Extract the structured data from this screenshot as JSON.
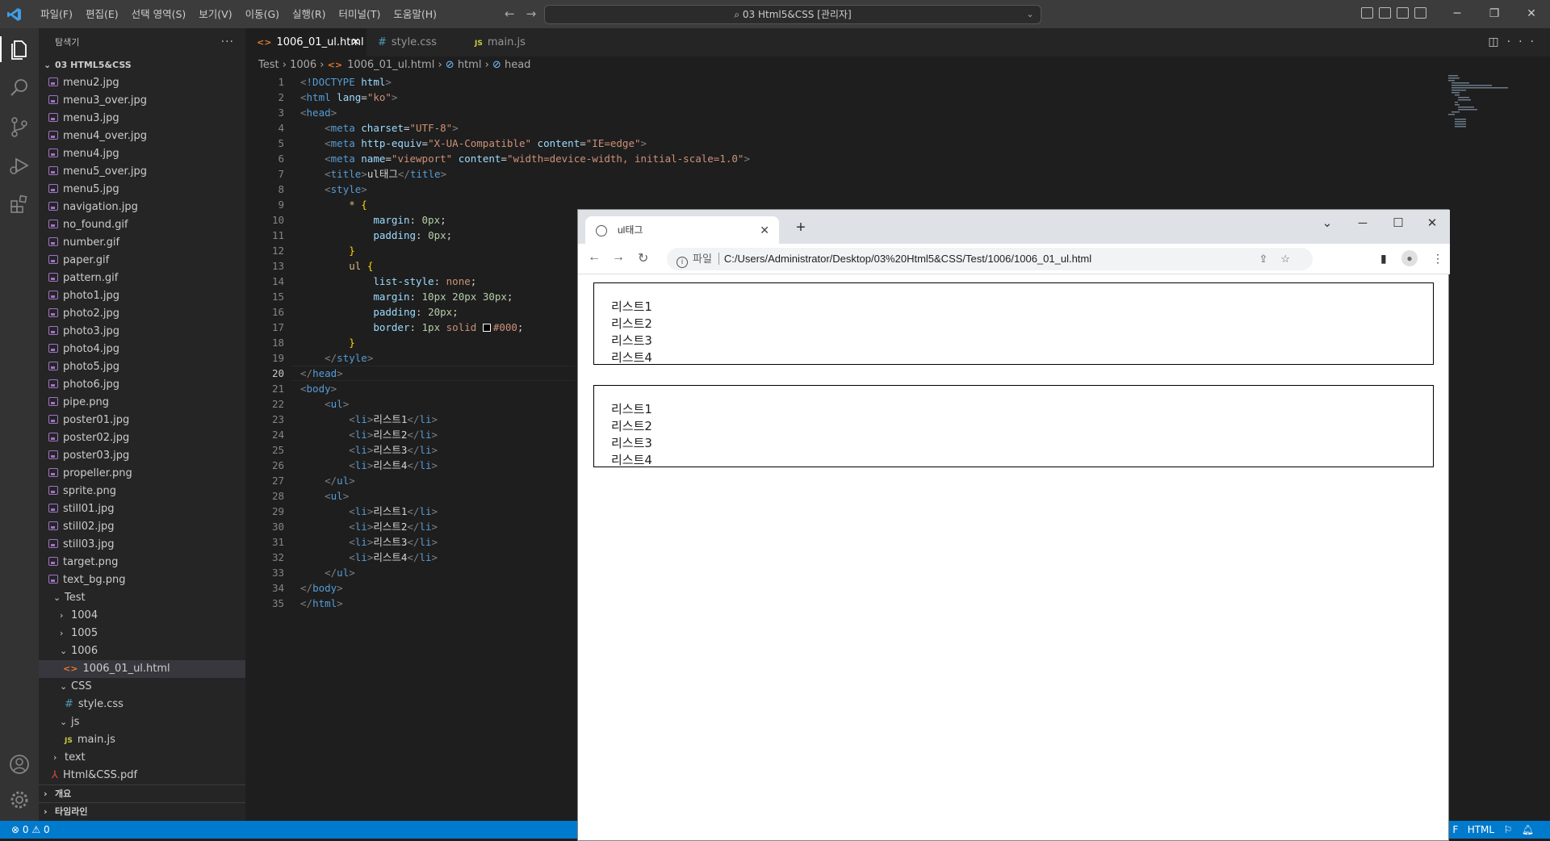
{
  "titlebar": {
    "menus": [
      "파일(F)",
      "편집(E)",
      "선택 영역(S)",
      "보기(V)",
      "이동(G)",
      "실행(R)",
      "터미널(T)",
      "도움말(H)"
    ],
    "command_center": "03 Html5&CSS [관리자]"
  },
  "sidebar": {
    "title": "탐색기",
    "root": "03 HTML5&CSS",
    "images": [
      "menu2.jpg",
      "menu3_over.jpg",
      "menu3.jpg",
      "menu4_over.jpg",
      "menu4.jpg",
      "menu5_over.jpg",
      "menu5.jpg",
      "navigation.jpg",
      "no_found.gif",
      "number.gif",
      "paper.gif",
      "pattern.gif",
      "photo1.jpg",
      "photo2.jpg",
      "photo3.jpg",
      "photo4.jpg",
      "photo5.jpg",
      "photo6.jpg",
      "pipe.png",
      "poster01.jpg",
      "poster02.jpg",
      "poster03.jpg",
      "propeller.png",
      "sprite.png",
      "still01.jpg",
      "still02.jpg",
      "still03.jpg",
      "target.png",
      "text_bg.png"
    ],
    "test_folder": "Test",
    "f1004": "1004",
    "f1005": "1005",
    "f1006": "1006",
    "active_file": "1006_01_ul.html",
    "css_folder": "CSS",
    "css_file": "style.css",
    "js_folder": "js",
    "js_file": "main.js",
    "text_folder": "text",
    "pdf_file": "Html&CSS.pdf",
    "outline": "개요",
    "timeline": "타임라인"
  },
  "tabs": [
    {
      "label": "1006_01_ul.html",
      "icon": "html-file-icon"
    },
    {
      "label": "style.css",
      "icon": "css-file-icon"
    },
    {
      "label": "main.js",
      "icon": "js-file-icon"
    }
  ],
  "breadcrumb": {
    "a": "Test",
    "b": "1006",
    "c": "1006_01_ul.html",
    "d": "html",
    "e": "head"
  },
  "editor": {
    "line_count": 35,
    "current_line": 20,
    "lines": [
      "<!DOCTYPE html>",
      "<html lang=\"ko\">",
      "<head>",
      "    <meta charset=\"UTF-8\">",
      "    <meta http-equiv=\"X-UA-Compatible\" content=\"IE=edge\">",
      "    <meta name=\"viewport\" content=\"width=device-width, initial-scale=1.0\">",
      "    <title>ul태그</title>",
      "    <style>",
      "        * {",
      "            margin: 0px;",
      "            padding: 0px;",
      "        }",
      "        ul {",
      "            list-style: none;",
      "            margin: 10px 20px 30px;",
      "            padding: 20px;",
      "            border: 1px solid #000;",
      "        }",
      "    </style>",
      "</head>",
      "<body>",
      "    <ul>",
      "        <li>리스트1</li>",
      "        <li>리스트2</li>",
      "        <li>리스트3</li>",
      "        <li>리스트4</li>",
      "    </ul>",
      "    <ul>",
      "        <li>리스트1</li>",
      "        <li>리스트2</li>",
      "        <li>리스트3</li>",
      "        <li>리스트4</li>",
      "    </ul>",
      "</body>",
      "</html>"
    ]
  },
  "statusbar": {
    "errors": "0",
    "warnings": "0",
    "language": "HTML",
    "partial_left": "F"
  },
  "browser": {
    "tab_title": "ul태그",
    "url_label": "파일",
    "url": "C:/Users/Administrator/Desktop/03%20Html5&CSS/Test/1006/1006_01_ul.html",
    "lists": [
      [
        "리스트1",
        "리스트2",
        "리스트3",
        "리스트4"
      ],
      [
        "리스트1",
        "리스트2",
        "리스트3",
        "리스트4"
      ]
    ]
  },
  "colors": {
    "statusbar": "#007acc",
    "titlebar": "#3c3c3c",
    "sidebar": "#252526",
    "editor": "#1e1e1e",
    "activity": "#333333"
  }
}
